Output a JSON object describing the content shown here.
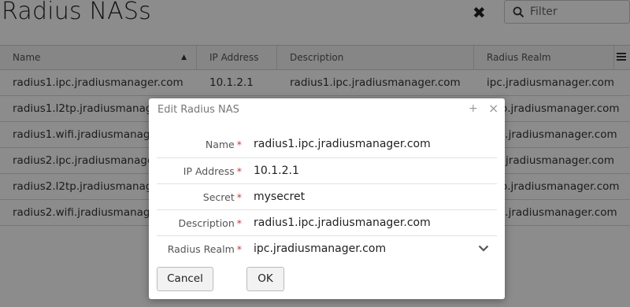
{
  "header": {
    "title": "Radius NASs",
    "clear_icon": "✖",
    "filter_placeholder": "Filter"
  },
  "grid": {
    "columns": [
      "Name",
      "IP Address",
      "Description",
      "Radius Realm"
    ],
    "rows": [
      [
        "radius1.ipc.jradiusmanager.com",
        "10.1.2.1",
        "radius1.ipc.jradiusmanager.com",
        "ipc.jradiusmanager.com"
      ],
      [
        "radius1.l2tp.jradiusmanager",
        "",
        "",
        "l2tp.jradiusmanager.com"
      ],
      [
        "radius1.wifi.jradiusmanager.",
        "",
        "",
        "wifi.jradiusmanager.com"
      ],
      [
        "radius2.ipc.jradiusmanager.",
        "",
        "",
        "ipc.jradiusmanager.com"
      ],
      [
        "radius2.l2tp.jradiusmanager",
        "",
        "",
        "l2tp.jradiusmanager.com"
      ],
      [
        "radius2.wifi.jradiusmanager.",
        "",
        "",
        "wifi.jradiusmanager.com"
      ]
    ]
  },
  "dialog": {
    "title": "Edit Radius NAS",
    "fields": [
      {
        "label": "Name",
        "value": "radius1.ipc.jradiusmanager.com"
      },
      {
        "label": "IP Address",
        "value": "10.1.2.1"
      },
      {
        "label": "Secret",
        "value": "mysecret"
      },
      {
        "label": "Description",
        "value": "radius1.ipc.jradiusmanager.com"
      },
      {
        "label": "Radius Realm",
        "value": "ipc.jradiusmanager.com"
      }
    ],
    "required_marker": "*",
    "maximize_icon": "+",
    "close_icon": "×",
    "cancel_label": "Cancel",
    "ok_label": "OK"
  },
  "colors": {
    "required": "#e03030",
    "overlay": "rgba(0,0,0,0.45)"
  }
}
